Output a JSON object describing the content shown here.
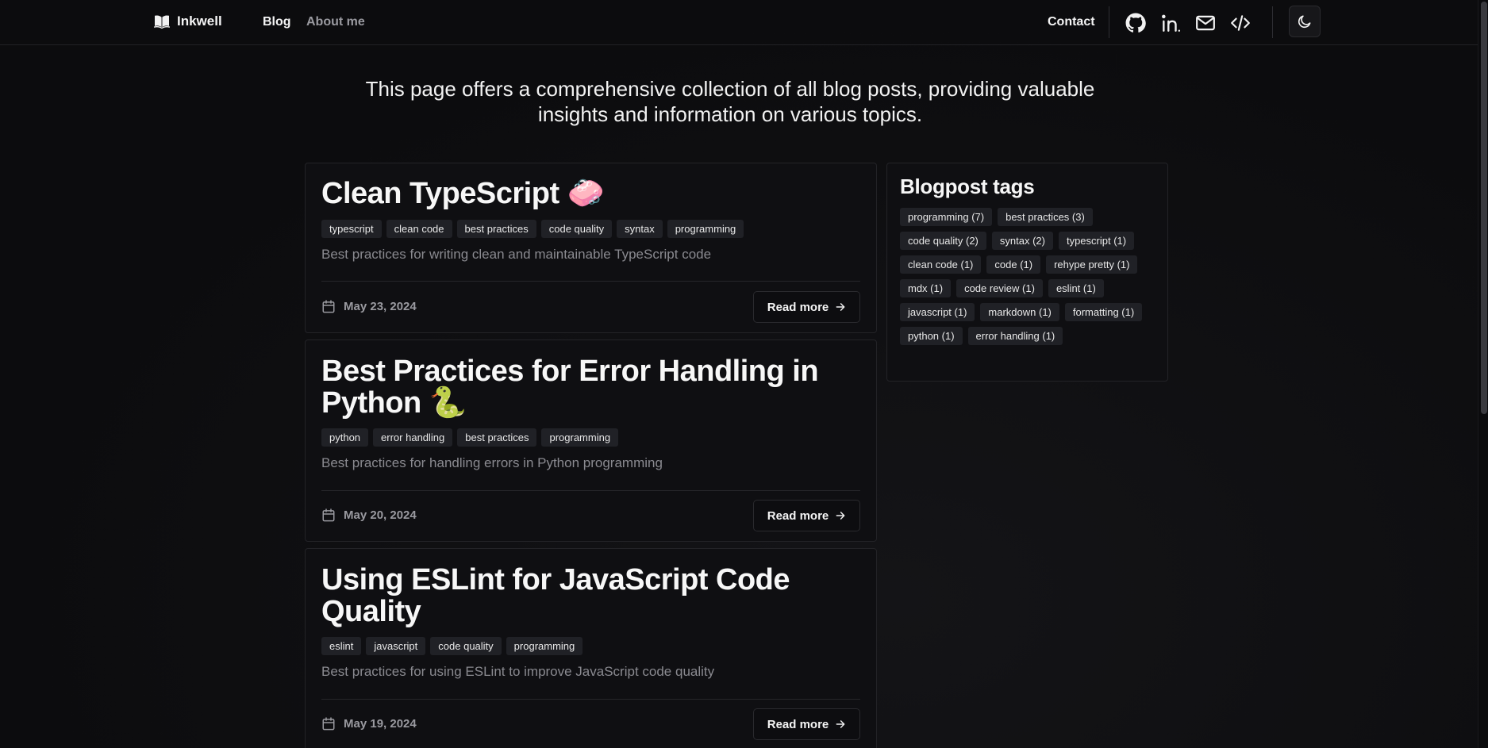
{
  "header": {
    "logo": "Inkwell",
    "nav": [
      {
        "label": "Blog"
      },
      {
        "label": "About me"
      }
    ],
    "contact": "Contact",
    "icons": [
      "github-icon",
      "linkedin-icon",
      "mail-icon",
      "code-icon"
    ],
    "theme_icon": "moon-icon"
  },
  "intro": "This page offers a comprehensive collection of all blog posts, providing valuable insights and information on various topics.",
  "posts": [
    {
      "title": "Clean TypeScript 🧼",
      "tags": [
        "typescript",
        "clean code",
        "best practices",
        "code quality",
        "syntax",
        "programming"
      ],
      "description": "Best practices for writing clean and maintainable TypeScript code",
      "date": "May 23, 2024",
      "read_more": "Read more"
    },
    {
      "title": "Best Practices for Error Handling in Python 🐍",
      "tags": [
        "python",
        "error handling",
        "best practices",
        "programming"
      ],
      "description": "Best practices for handling errors in Python programming",
      "date": "May 20, 2024",
      "read_more": "Read more"
    },
    {
      "title": "Using ESLint for JavaScript Code Quality",
      "tags": [
        "eslint",
        "javascript",
        "code quality",
        "programming"
      ],
      "description": "Best practices for using ESLint to improve JavaScript code quality",
      "date": "May 19, 2024",
      "read_more": "Read more"
    }
  ],
  "sidebar": {
    "title": "Blogpost tags",
    "tags": [
      "programming (7)",
      "best practices (3)",
      "code quality (2)",
      "syntax (2)",
      "typescript (1)",
      "clean code (1)",
      "code (1)",
      "rehype pretty (1)",
      "mdx (1)",
      "code review (1)",
      "eslint (1)",
      "javascript (1)",
      "markdown (1)",
      "formatting (1)",
      "python (1)",
      "error handling (1)"
    ]
  }
}
